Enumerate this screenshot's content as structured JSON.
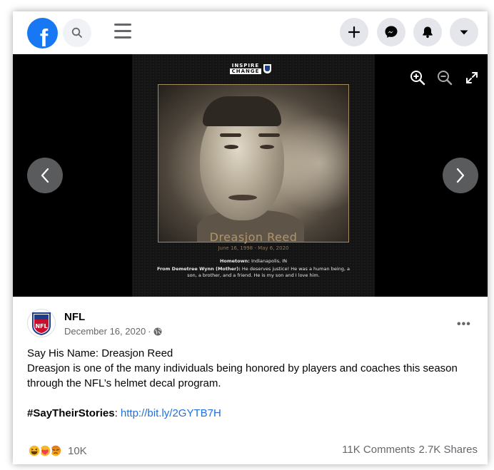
{
  "colors": {
    "facebook_blue": "#1877f2",
    "link_blue": "#216fdb",
    "viewer_bg": "#000000",
    "poster_gold": "#b0956a",
    "secondary_text": "#65676b"
  },
  "topbar": {
    "logo_letter": "f",
    "icons": [
      "search-icon",
      "menu-icon",
      "plus-icon",
      "messenger-icon",
      "bell-icon",
      "dropdown-caret-icon"
    ]
  },
  "viewer": {
    "poster": {
      "logo_line1": "INSPIRE",
      "logo_line2": "CHANGE",
      "name": "Dreasjon Reed",
      "dates": "June 16, 1998 - May 6, 2020",
      "hometown_label": "Hometown:",
      "hometown_value": "Indianapolis, IN",
      "quote_attribution": "From Demetree Wynn (Mother):",
      "quote_text": "He deserves justice! He was a human being, a son, a brother, and a friend. He is my son and I love him."
    },
    "tools": [
      "zoom-in-icon",
      "zoom-out-icon",
      "fullscreen-icon"
    ]
  },
  "post": {
    "page_name": "NFL",
    "avatar_text": "NFL",
    "date": "December 16, 2020",
    "date_separator": "·",
    "more_label": "•••",
    "line1": "Say His Name: Dreasjon Reed",
    "line2": "Dreasjon is one of the many individuals being honored by players and coaches this season through the NFL’s helmet decal program.",
    "hashtag": "#SayTheirStories",
    "hashtag_suffix": ":",
    "link": "http://bit.ly/2GYTB7H"
  },
  "engagement": {
    "reaction_count": "10K",
    "comments": "11K Comments",
    "shares": "2.7K Shares",
    "reaction_types": [
      "haha",
      "care",
      "angry"
    ]
  }
}
